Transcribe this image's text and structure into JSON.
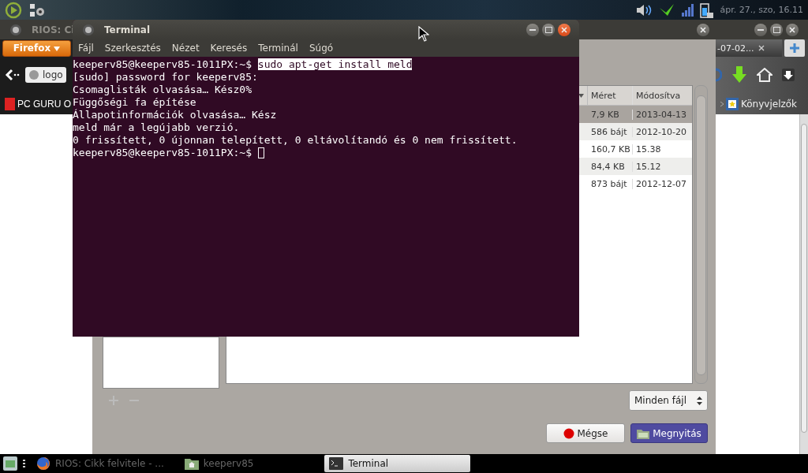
{
  "top_panel": {
    "clock": "ápr. 27., szo, 16.11"
  },
  "firefox": {
    "title": "RIOS: Ci",
    "menu_button": "Firefox",
    "url": "logo",
    "bookmark": "PC GURU O",
    "tab": "-07-02...",
    "bookmarks_menu": "Könyvjelzők"
  },
  "file_dialog": {
    "columns": [
      "Méret",
      "Módosítva"
    ],
    "rows": [
      {
        "size": "7,9 KB",
        "modified": "2013-04-13",
        "selected": true
      },
      {
        "size": "586 bájt",
        "modified": "2012-10-20",
        "selected": false
      },
      {
        "size": "160,7 KB",
        "modified": "15.38",
        "selected": false
      },
      {
        "size": "84,4 KB",
        "modified": "15.12",
        "selected": false
      },
      {
        "size": "873 bájt",
        "modified": "2012-12-07",
        "selected": false
      }
    ],
    "filter": "Minden fájl",
    "buttons": [
      {
        "label": "Mégse",
        "kind": "cancel"
      },
      {
        "label": "Megnyitás",
        "kind": "open"
      }
    ]
  },
  "terminal": {
    "title": "Terminal",
    "menu": [
      "Fájl",
      "Szerkesztés",
      "Nézet",
      "Keresés",
      "Terminál",
      "Súgó"
    ],
    "lines": [
      {
        "kind": "command",
        "prompt": "keeperv85@keeperv85-1011PX:~$",
        "command": "sudo apt-get install meld"
      },
      {
        "kind": "output",
        "text": "[sudo] password for keeperv85:"
      },
      {
        "kind": "output",
        "text": "Csomaglisták olvasása… Kész0%"
      },
      {
        "kind": "output",
        "text": "Függőségi fa építése"
      },
      {
        "kind": "output",
        "text": "Állapotinformációk olvasása… Kész"
      },
      {
        "kind": "output",
        "text": "meld már a legújabb verzió."
      },
      {
        "kind": "output",
        "text": "0 frissített, 0 újonnan telepített, 0 eltávolítandó és 0 nem frissített."
      },
      {
        "kind": "input",
        "prompt": "keeperv85@keeperv85-1011PX:~$",
        "cursor": true
      }
    ]
  },
  "taskbar": {
    "items": [
      {
        "label": "RIOS: Cikk felvitele - ...",
        "kind": "browser",
        "selected": false
      },
      {
        "label": "keeperv85",
        "kind": "folder",
        "selected": false
      },
      {
        "label": "Terminal",
        "kind": "terminal",
        "selected": true
      }
    ]
  }
}
